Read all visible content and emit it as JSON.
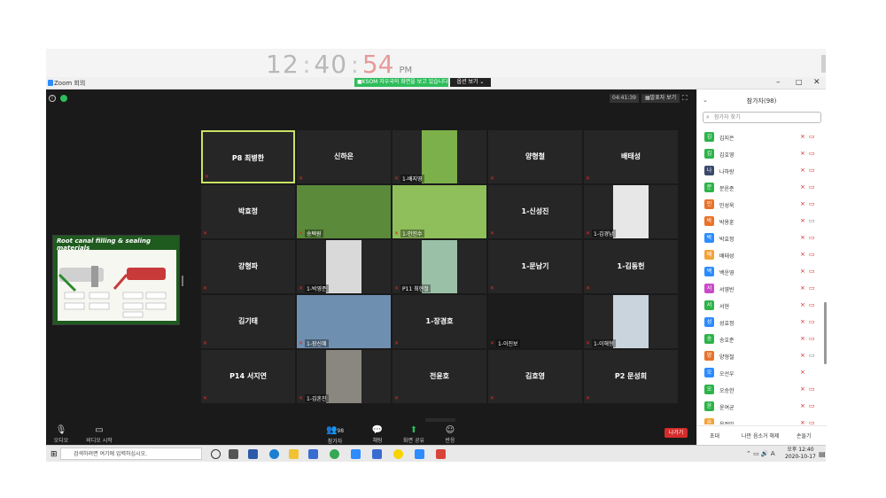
{
  "clock": {
    "hours": "12",
    "minutes": "40",
    "seconds": "54",
    "ampm": "PM"
  },
  "window": {
    "title": "Zoom 회의",
    "minimize": "–",
    "maximize": "□",
    "close": "✕"
  },
  "share": {
    "banner": "■KSOM 자우국의 화면을 보고 있습니다.",
    "options": "옵션 보기 ⌄"
  },
  "meeting": {
    "timer": "04:41:39",
    "view_label": "▦발표자 보기",
    "fullscreen": "⛶"
  },
  "slide": {
    "title": "Root canal filling & sealing materials"
  },
  "grid": {
    "tiles": [
      {
        "name": "P8 최병한",
        "label": "",
        "active": true
      },
      {
        "name": "신하은",
        "label": ""
      },
      {
        "name": "",
        "label": "1-배지영",
        "photo": "#7bb04a"
      },
      {
        "name": "양형철",
        "label": ""
      },
      {
        "name": "배태성",
        "label": ""
      },
      {
        "name": "박효정",
        "label": ""
      },
      {
        "name": "",
        "label": "송택원",
        "photo": "#5a8a3a"
      },
      {
        "name": "",
        "label": "1-안진수",
        "photo": "#8fbf5a"
      },
      {
        "name": "1-신성진",
        "label": ""
      },
      {
        "name": "",
        "label": "1-김경남",
        "photo": "#e7e7e7"
      },
      {
        "name": "강형파",
        "label": ""
      },
      {
        "name": "",
        "label": "1-박영준",
        "photo": "#d9d9d9"
      },
      {
        "name": "",
        "label": "P11 최현철",
        "photo": "#9bc0a8"
      },
      {
        "name": "1-문남기",
        "label": ""
      },
      {
        "name": "1-김동헌",
        "label": ""
      },
      {
        "name": "김기태",
        "label": ""
      },
      {
        "name": "",
        "label": "1-장신혜",
        "photo": "#6f8fb0"
      },
      {
        "name": "1-장경호",
        "label": ""
      },
      {
        "name": "",
        "label": "1-이진보",
        "photo": "#1c1c1c"
      },
      {
        "name": "",
        "label": "1-이해형",
        "photo": "#c9d4dd"
      },
      {
        "name": "P14 서지연",
        "label": ""
      },
      {
        "name": "",
        "label": "1-김혼진",
        "photo": "#8a8780"
      },
      {
        "name": "전윤호",
        "label": ""
      },
      {
        "name": "김호영",
        "label": ""
      },
      {
        "name": "P2 문성희",
        "label": ""
      }
    ],
    "down_arrow": "⌄"
  },
  "toolbar": {
    "audio": "오디오",
    "video": "비디오 시작",
    "participants": "참가자",
    "participants_count": "98",
    "chat": "채팅",
    "share": "화면 공유",
    "reactions": "반응",
    "end": "나가기"
  },
  "panel": {
    "title": "참가자(98)",
    "search_placeholder": "참가자 찾기",
    "participants": [
      {
        "initial": "김",
        "name": "김지은",
        "color": "#2db34a",
        "cam": "off"
      },
      {
        "initial": "김",
        "name": "김호영",
        "color": "#2db34a",
        "cam": "off"
      },
      {
        "initial": "나",
        "name": "나하랑",
        "color": "#3b4a6b",
        "cam": "off"
      },
      {
        "initial": "문",
        "name": "문윤준",
        "color": "#2db34a",
        "cam": "off"
      },
      {
        "initial": "민",
        "name": "민성욱",
        "color": "#e8732b",
        "cam": "off"
      },
      {
        "initial": "박",
        "name": "박용훈",
        "color": "#e8732b",
        "cam": "on"
      },
      {
        "initial": "박",
        "name": "박효정",
        "color": "#2d8cff",
        "cam": "off"
      },
      {
        "initial": "배",
        "name": "배태성",
        "color": "#f2a33a",
        "cam": "off"
      },
      {
        "initial": "백",
        "name": "백운영",
        "color": "#2d8cff",
        "cam": "off"
      },
      {
        "initial": "서영",
        "name": "서영빈",
        "color": "#c94ac9",
        "cam": "off"
      },
      {
        "initial": "서",
        "name": "서현",
        "color": "#2db34a",
        "cam": "off"
      },
      {
        "initial": "성",
        "name": "성효정",
        "color": "#2d8cff",
        "cam": "off"
      },
      {
        "initial": "송",
        "name": "송호준",
        "color": "#2db34a",
        "cam": "off"
      },
      {
        "initial": "양",
        "name": "양형철",
        "color": "#e8732b",
        "cam": "on"
      },
      {
        "initial": "오",
        "name": "오선우",
        "color": "#2d8cff",
        "cam": "none"
      },
      {
        "initial": "오",
        "name": "오승한",
        "color": "#2db34a",
        "cam": "off"
      },
      {
        "initial": "윤",
        "name": "윤여균",
        "color": "#2db34a",
        "cam": "off"
      },
      {
        "initial": "윤",
        "name": "윤정미",
        "color": "#f2a33a",
        "cam": "off"
      }
    ],
    "invite": "초대",
    "mute_all": "나만 음소거 해제",
    "raise_hand": "손들기"
  },
  "taskbar": {
    "search_placeholder": "검색하려면 여기에 입력하십시오.",
    "time": "오후 12:40",
    "date": "2020-10-17",
    "ime": "A"
  }
}
